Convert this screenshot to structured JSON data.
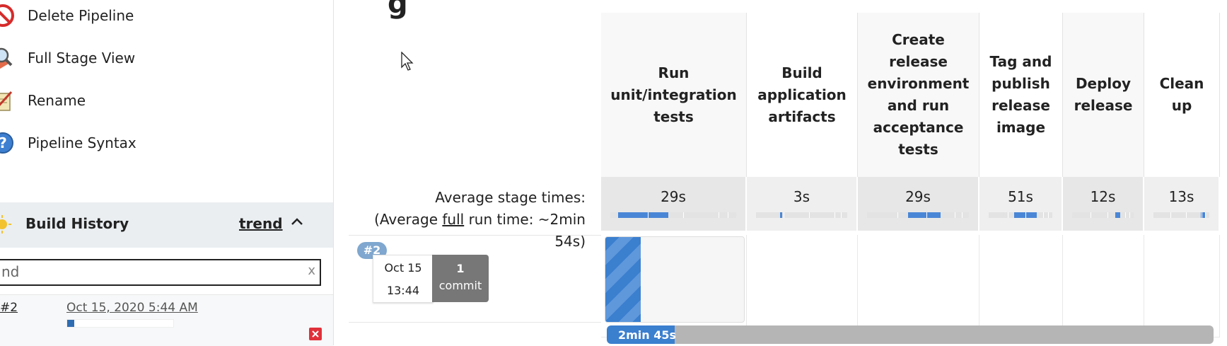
{
  "sidebar": {
    "tasks": [
      {
        "label": "Delete Pipeline",
        "icon": "delete-icon"
      },
      {
        "label": "Full Stage View",
        "icon": "magnifier-icon"
      },
      {
        "label": "Rename",
        "icon": "notepad-icon"
      },
      {
        "label": "Pipeline Syntax",
        "icon": "help-icon"
      }
    ]
  },
  "build_history": {
    "title": "Build History",
    "trend_label": "trend",
    "search_value": "nd",
    "clear_glyph": "x",
    "builds": [
      {
        "number": "#2",
        "date": "Oct 15, 2020 5:44 AM",
        "progress": 0.07
      }
    ]
  },
  "stage_view": {
    "heading_fragment": "g",
    "avg_label_line1": "Average stage times:",
    "avg_label_prefix": "(Average ",
    "avg_label_full": "full",
    "avg_label_suffix": " run time: ~2min 54s)",
    "stages": [
      {
        "name": "Run unit/integration tests",
        "avg": "29s"
      },
      {
        "name": "Build application artifacts",
        "avg": "3s"
      },
      {
        "name": "Create release environment and run acceptance tests",
        "avg": "29s"
      },
      {
        "name": "Tag and publish release image",
        "avg": "51s"
      },
      {
        "name": "Deploy release",
        "avg": "12s"
      },
      {
        "name": "Clean up",
        "avg": "13s"
      }
    ],
    "run": {
      "badge": "#2",
      "date": "Oct 15",
      "time": "13:44",
      "commit_count": "1",
      "commit_label": "commit",
      "elapsed": "2min 45s"
    }
  }
}
